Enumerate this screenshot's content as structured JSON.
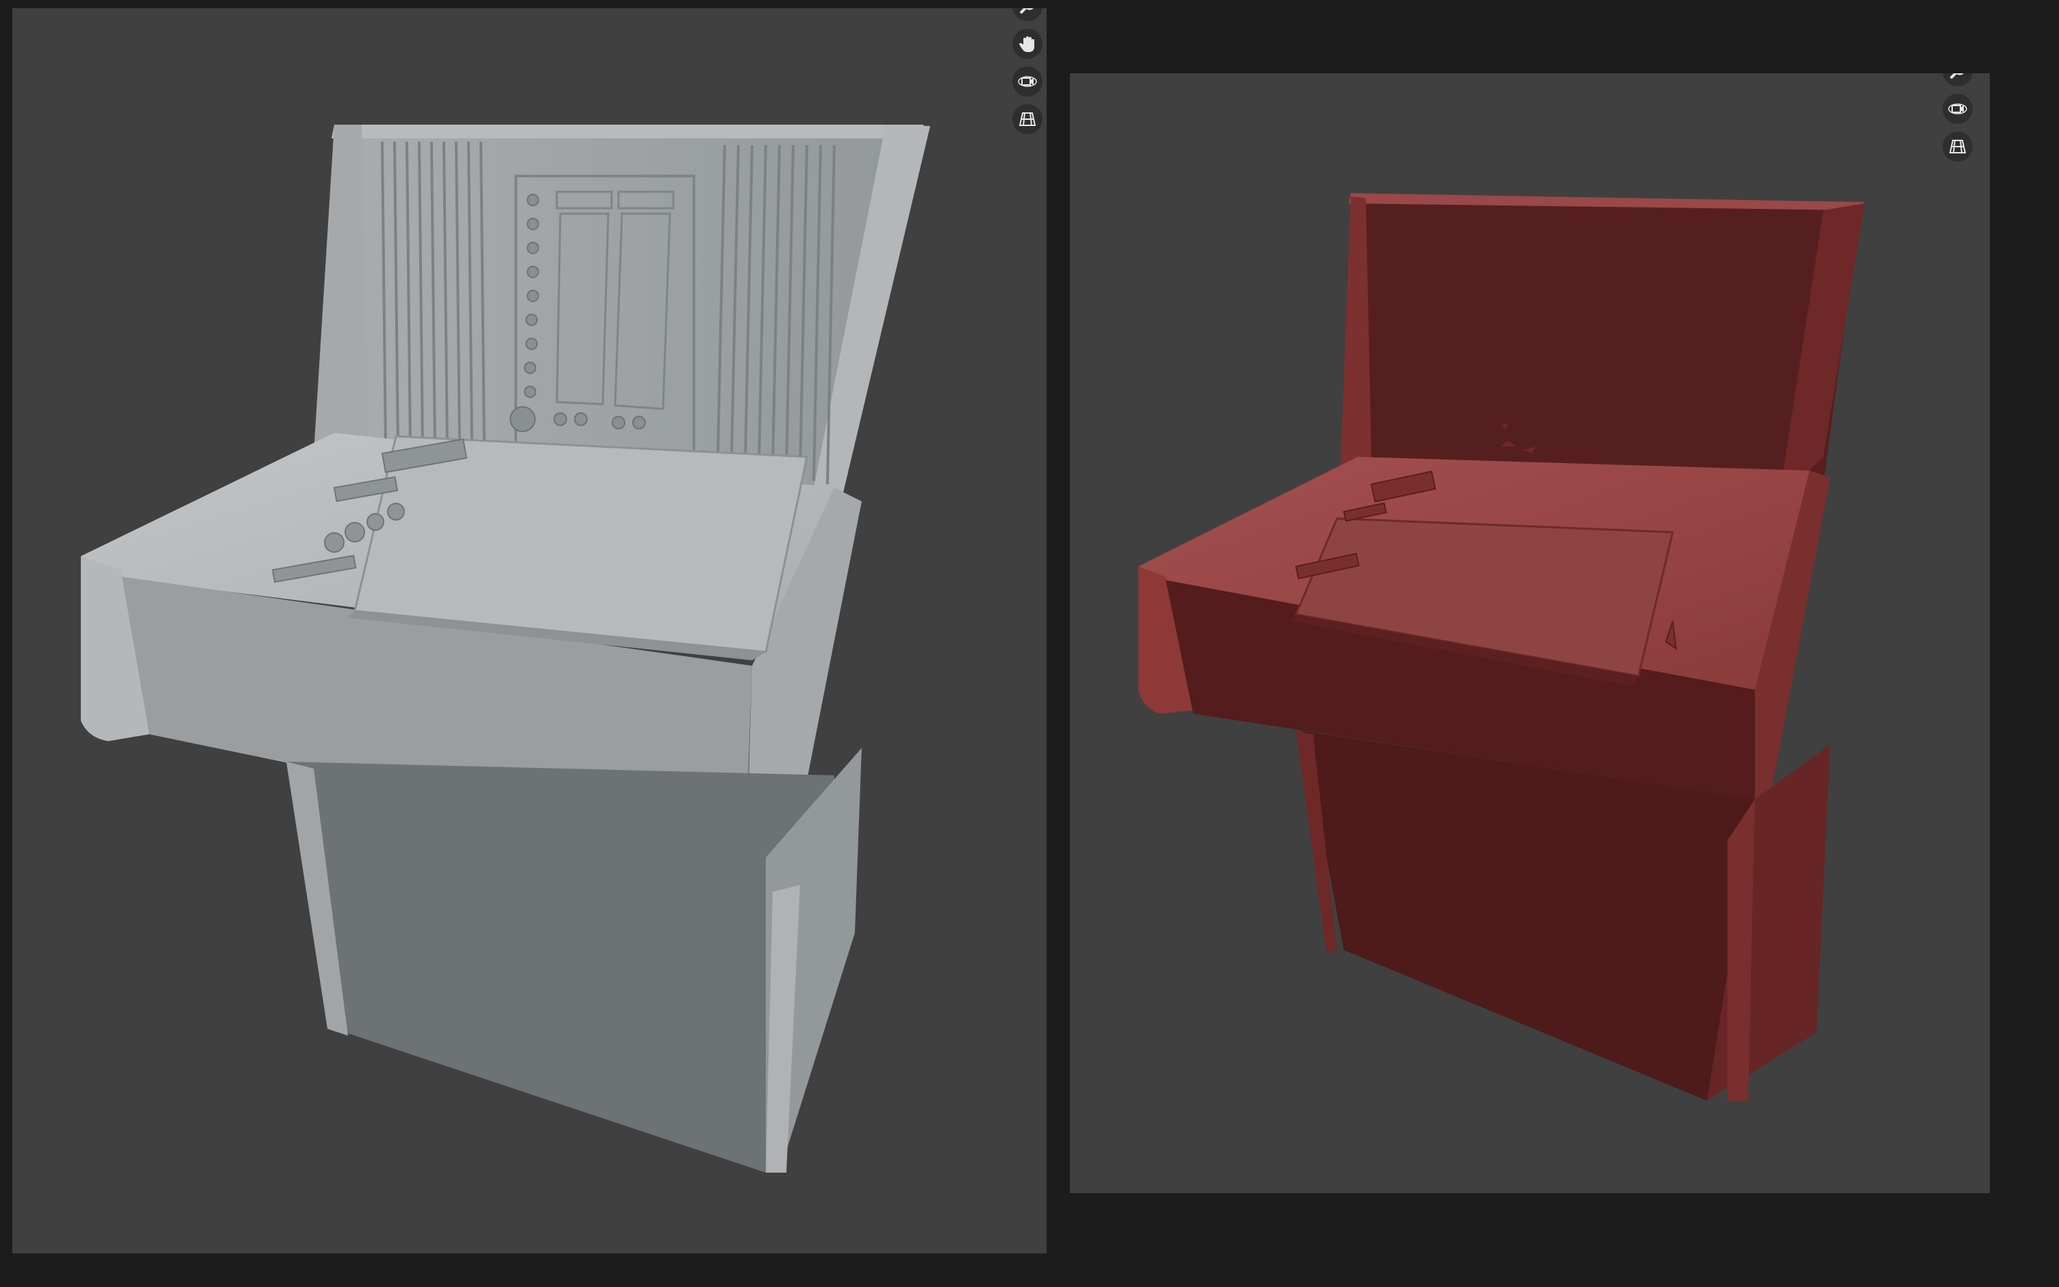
{
  "window": {
    "background": "#1c1c1c",
    "viewport_background": "#404040"
  },
  "viewports": [
    {
      "name": "left-viewport",
      "shading": "solid",
      "model_color": "#9ba0a3",
      "nav_icons": [
        "zoom-icon",
        "hand-pan-icon",
        "camera-orbit-icon",
        "ortho-grid-icon"
      ]
    },
    {
      "name": "right-viewport",
      "shading": "material",
      "model_color": "#7a2424",
      "nav_icons": [
        "zoom-icon",
        "camera-orbit-icon",
        "ortho-grid-icon"
      ]
    }
  ]
}
